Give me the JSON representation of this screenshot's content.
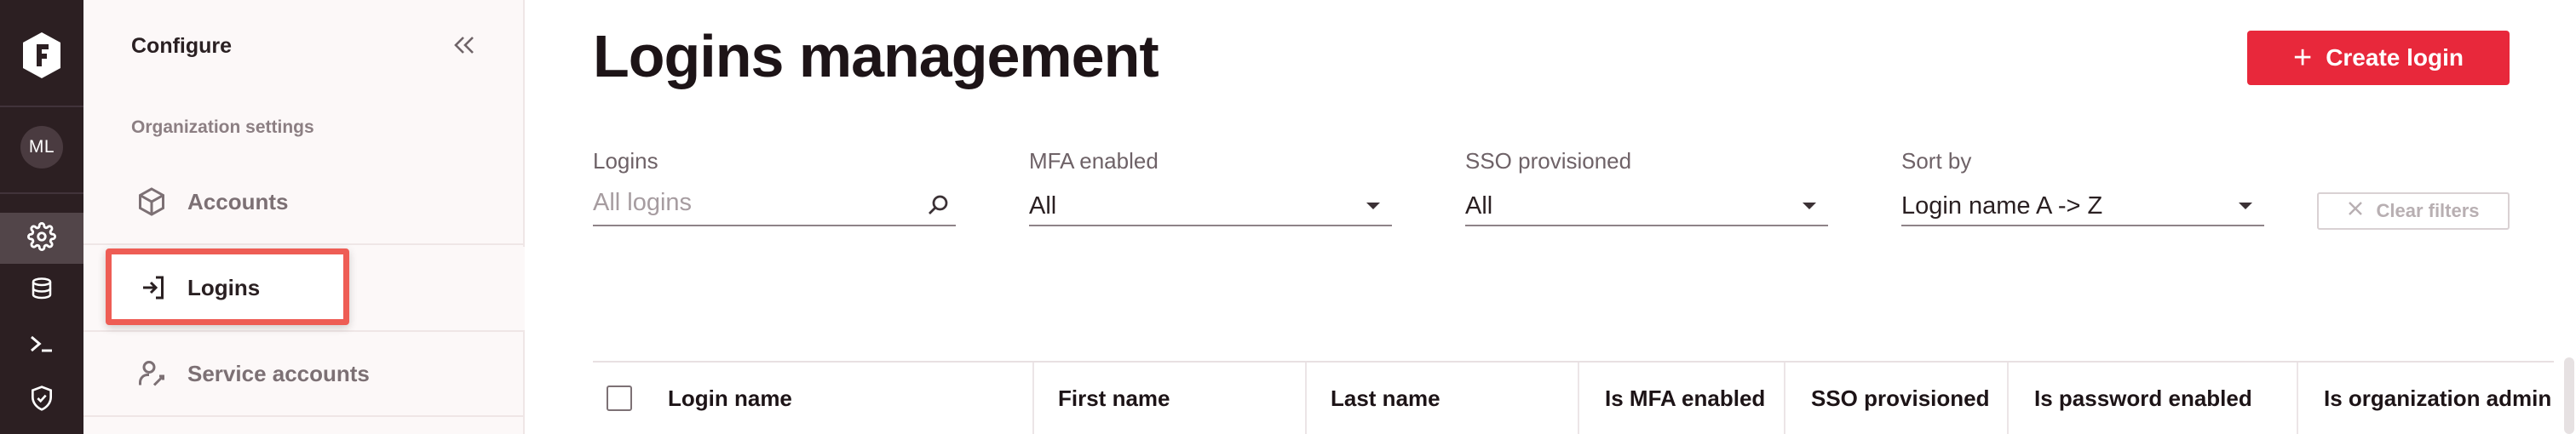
{
  "rail": {
    "avatar_initials": "ML",
    "nav": [
      {
        "name": "settings-gear-icon",
        "active": true
      },
      {
        "name": "database-icon",
        "active": false
      },
      {
        "name": "terminal-icon",
        "active": false
      },
      {
        "name": "shield-check-icon",
        "active": false
      }
    ]
  },
  "sidebar": {
    "title": "Configure",
    "section_label": "Organization settings",
    "items": [
      {
        "label": "Accounts",
        "icon": "cube-icon"
      },
      {
        "label": "Logins",
        "icon": "login-arrow-icon",
        "selected": true
      },
      {
        "label": "Service accounts",
        "icon": "service-account-icon"
      }
    ]
  },
  "main": {
    "title": "Logins management",
    "create_button": "Create login",
    "filters": {
      "logins": {
        "label": "Logins",
        "placeholder": "All logins",
        "value": ""
      },
      "mfa": {
        "label": "MFA enabled",
        "value": "All"
      },
      "sso": {
        "label": "SSO provisioned",
        "value": "All"
      },
      "sort": {
        "label": "Sort by",
        "value": "Login name A -> Z"
      }
    },
    "clear_filters": "Clear filters",
    "table": {
      "columns": [
        "Login name",
        "First name",
        "Last name",
        "Is MFA enabled",
        "SSO provisioned",
        "Is password enabled",
        "Is organization admin"
      ]
    }
  },
  "colors": {
    "rail_bg": "#2c1f22",
    "accent_red": "#e8283b",
    "highlight_border": "#ee5d55"
  }
}
